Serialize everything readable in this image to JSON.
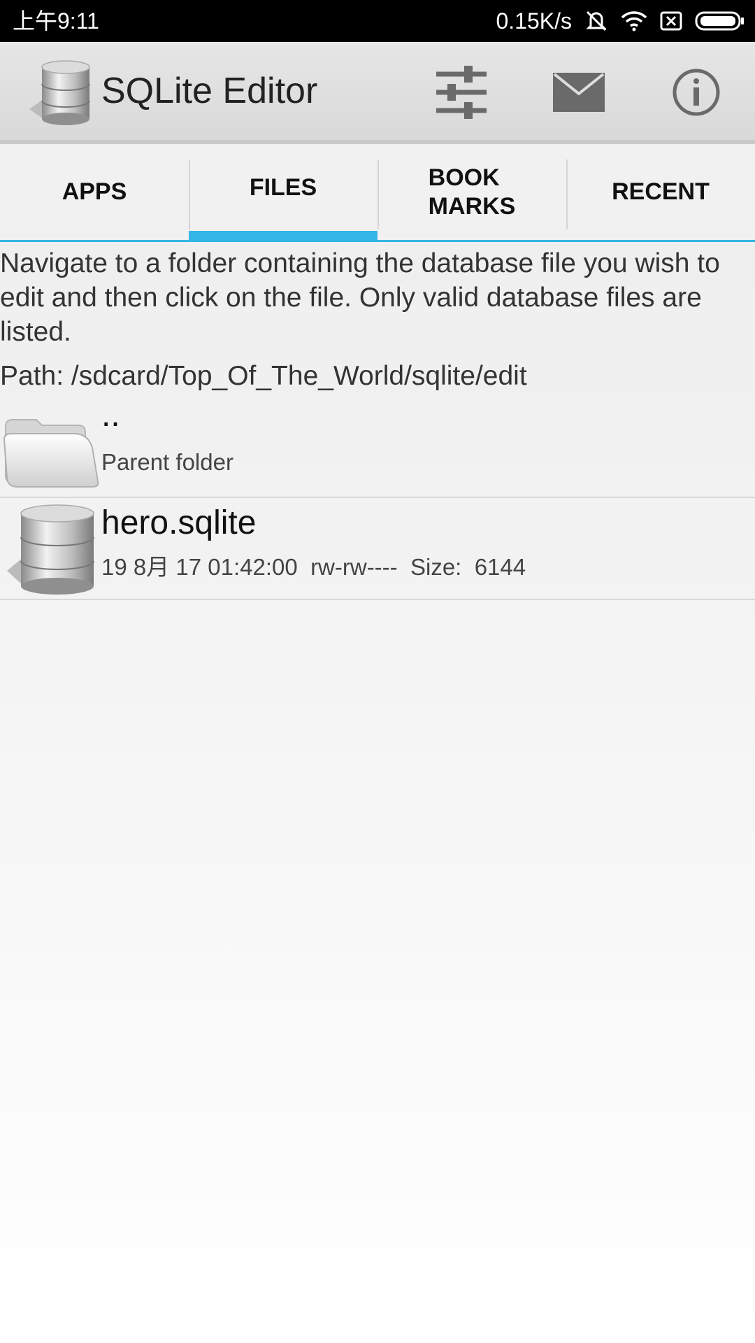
{
  "status_bar": {
    "time": "上午9:11",
    "net_speed": "0.15K/s",
    "icons": [
      "mute-icon",
      "wifi-icon",
      "sim-off-icon",
      "battery-icon"
    ]
  },
  "action_bar": {
    "title": "SQLite Editor",
    "icons": [
      "database-logo-icon",
      "settings-sliders-icon",
      "mail-icon",
      "info-icon"
    ]
  },
  "tabs": [
    {
      "label": "APPS"
    },
    {
      "label": "FILES",
      "active": true
    },
    {
      "label_line1": "BOOK",
      "label_line2": "MARKS"
    },
    {
      "label": "RECENT"
    }
  ],
  "main": {
    "instructions": "Navigate to a folder containing the database file you wish to edit and then click on the file. Only valid database files are listed.",
    "path": "Path: /sdcard/Top_Of_The_World/sqlite/edit",
    "files": [
      {
        "name": "..",
        "detail": "Parent folder",
        "icon": "folder-icon"
      },
      {
        "name": "hero.sqlite",
        "detail": "19 8月 17 01:42:00  rw-rw----  Size:  6144",
        "icon": "database-icon"
      }
    ]
  },
  "colors": {
    "accent": "#33b5e5",
    "status_bar": "#000000",
    "action_bar": "#e0e0e0"
  }
}
